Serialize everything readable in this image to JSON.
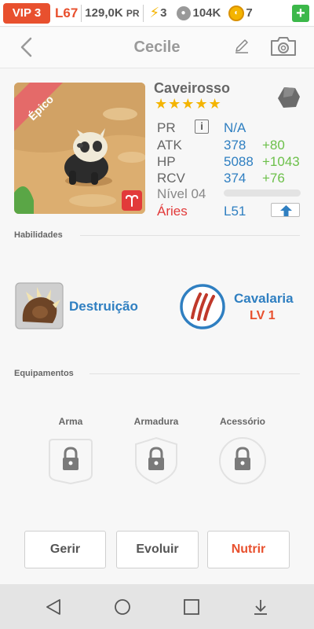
{
  "status": {
    "vip": "VIP 3",
    "level": "L67",
    "pr_amount": "129,0K",
    "pr_unit": "PR",
    "energy": "3",
    "paw_amount": "104K",
    "coins": "7",
    "add_label": "+"
  },
  "header": {
    "title": "Cecile"
  },
  "pet": {
    "species": "Caveirosso",
    "rarity": "Épico",
    "stars": "★★★★★",
    "stats": {
      "pr_label": "PR",
      "pr_value": "N/A",
      "info_label": "i",
      "atk_label": "ATK",
      "atk_value": "378",
      "atk_bonus": "+80",
      "hp_label": "HP",
      "hp_value": "5088",
      "hp_bonus": "+1043",
      "rcv_label": "RCV",
      "rcv_value": "374",
      "rcv_bonus": "+76",
      "level_label": "Nível 04",
      "xp_progress": 0,
      "sign_label": "Áries",
      "sign_level": "L51"
    }
  },
  "skills": {
    "section_title": "Habilidades",
    "items": [
      {
        "name": "Destruição"
      },
      {
        "name": "Cavalaria",
        "level": "LV 1"
      }
    ]
  },
  "equipment": {
    "section_title": "Equipamentos",
    "slots": [
      {
        "label": "Arma"
      },
      {
        "label": "Armadura"
      },
      {
        "label": "Acessório"
      }
    ]
  },
  "actions": {
    "manage": "Gerir",
    "evolve": "Evoluir",
    "feed": "Nutrir"
  },
  "colors": {
    "accent": "#e8502e",
    "blue": "#2f7fc1",
    "green": "#6cc04a",
    "gold": "#f4b400"
  }
}
